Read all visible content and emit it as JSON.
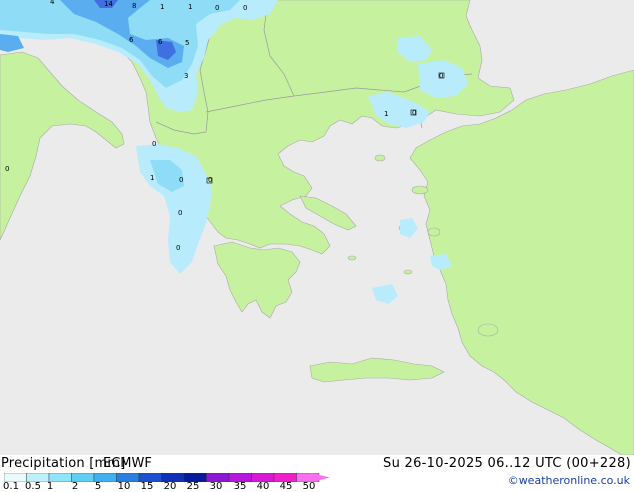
{
  "footer": {
    "title": "Precipitation [mm]",
    "model": "ECMWF",
    "datetime": "Su 26-10-2025 06..12 UTC (00+228)",
    "credit": "©weatheronline.co.uk"
  },
  "legend": {
    "ticks": [
      "0.1",
      "0.5",
      "1",
      "2",
      "5",
      "10",
      "15",
      "20",
      "25",
      "30",
      "35",
      "40",
      "45",
      "50"
    ],
    "colors": [
      "#e8fafc",
      "#bdf0fa",
      "#8ee4f8",
      "#5fd0f2",
      "#3fb1ec",
      "#2a7fe0",
      "#1b50d0",
      "#1030b8",
      "#081a9c",
      "#8c18d6",
      "#b818dc",
      "#dc18d8",
      "#f020c8",
      "#f870f0"
    ]
  },
  "colors": {
    "sea": "#ebebeb",
    "land": "#c6f2a0",
    "border": "#9a9a9a",
    "precip_light": "#b8ecfc",
    "precip_mid": "#8edcf6",
    "precip_strong": "#5aaef0",
    "precip_heavy": "#3f6fe0"
  },
  "map_labels": [
    {
      "id": "a1",
      "text": "4"
    },
    {
      "id": "a2",
      "text": "14"
    },
    {
      "id": "a3",
      "text": "8"
    },
    {
      "id": "a4",
      "text": "1"
    },
    {
      "id": "a5",
      "text": "1"
    },
    {
      "id": "a6",
      "text": "0"
    },
    {
      "id": "a7",
      "text": "0"
    },
    {
      "id": "a8",
      "text": "6"
    },
    {
      "id": "a9",
      "text": "6"
    },
    {
      "id": "a10",
      "text": "5"
    },
    {
      "id": "a11",
      "text": "3"
    },
    {
      "id": "a12",
      "text": "0"
    },
    {
      "id": "a13",
      "text": "1"
    },
    {
      "id": "a14",
      "text": "0"
    },
    {
      "id": "a15",
      "text": "0"
    },
    {
      "id": "a16",
      "text": "0"
    },
    {
      "id": "a17",
      "text": "1"
    },
    {
      "id": "a18",
      "text": "0"
    },
    {
      "id": "a19",
      "text": "0"
    },
    {
      "id": "a20",
      "text": "0"
    },
    {
      "id": "a21",
      "text": "0"
    }
  ]
}
